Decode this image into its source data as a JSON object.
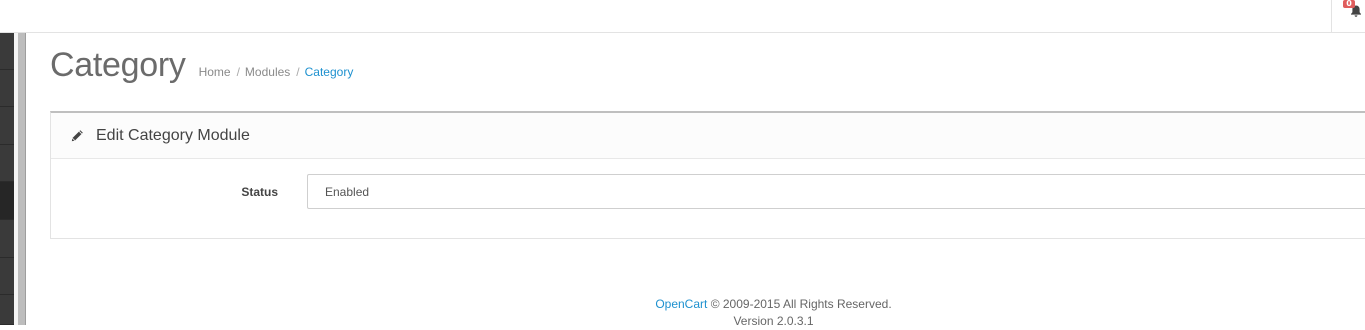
{
  "header": {
    "notifications_count": "0"
  },
  "page": {
    "title": "Category",
    "breadcrumb": [
      {
        "label": "Home"
      },
      {
        "label": "Modules"
      },
      {
        "label": "Category"
      }
    ]
  },
  "panel": {
    "title": "Edit Category Module",
    "form": {
      "status_label": "Status",
      "status_value": "Enabled"
    }
  },
  "footer": {
    "brand": "OpenCart",
    "copyright": "© 2009-2015 All Rights Reserved.",
    "version": "Version 2.0.3.1"
  },
  "colors": {
    "link": "#1e91cf",
    "sidebar": "#3a3a3a",
    "badge": "#e05d5d"
  }
}
